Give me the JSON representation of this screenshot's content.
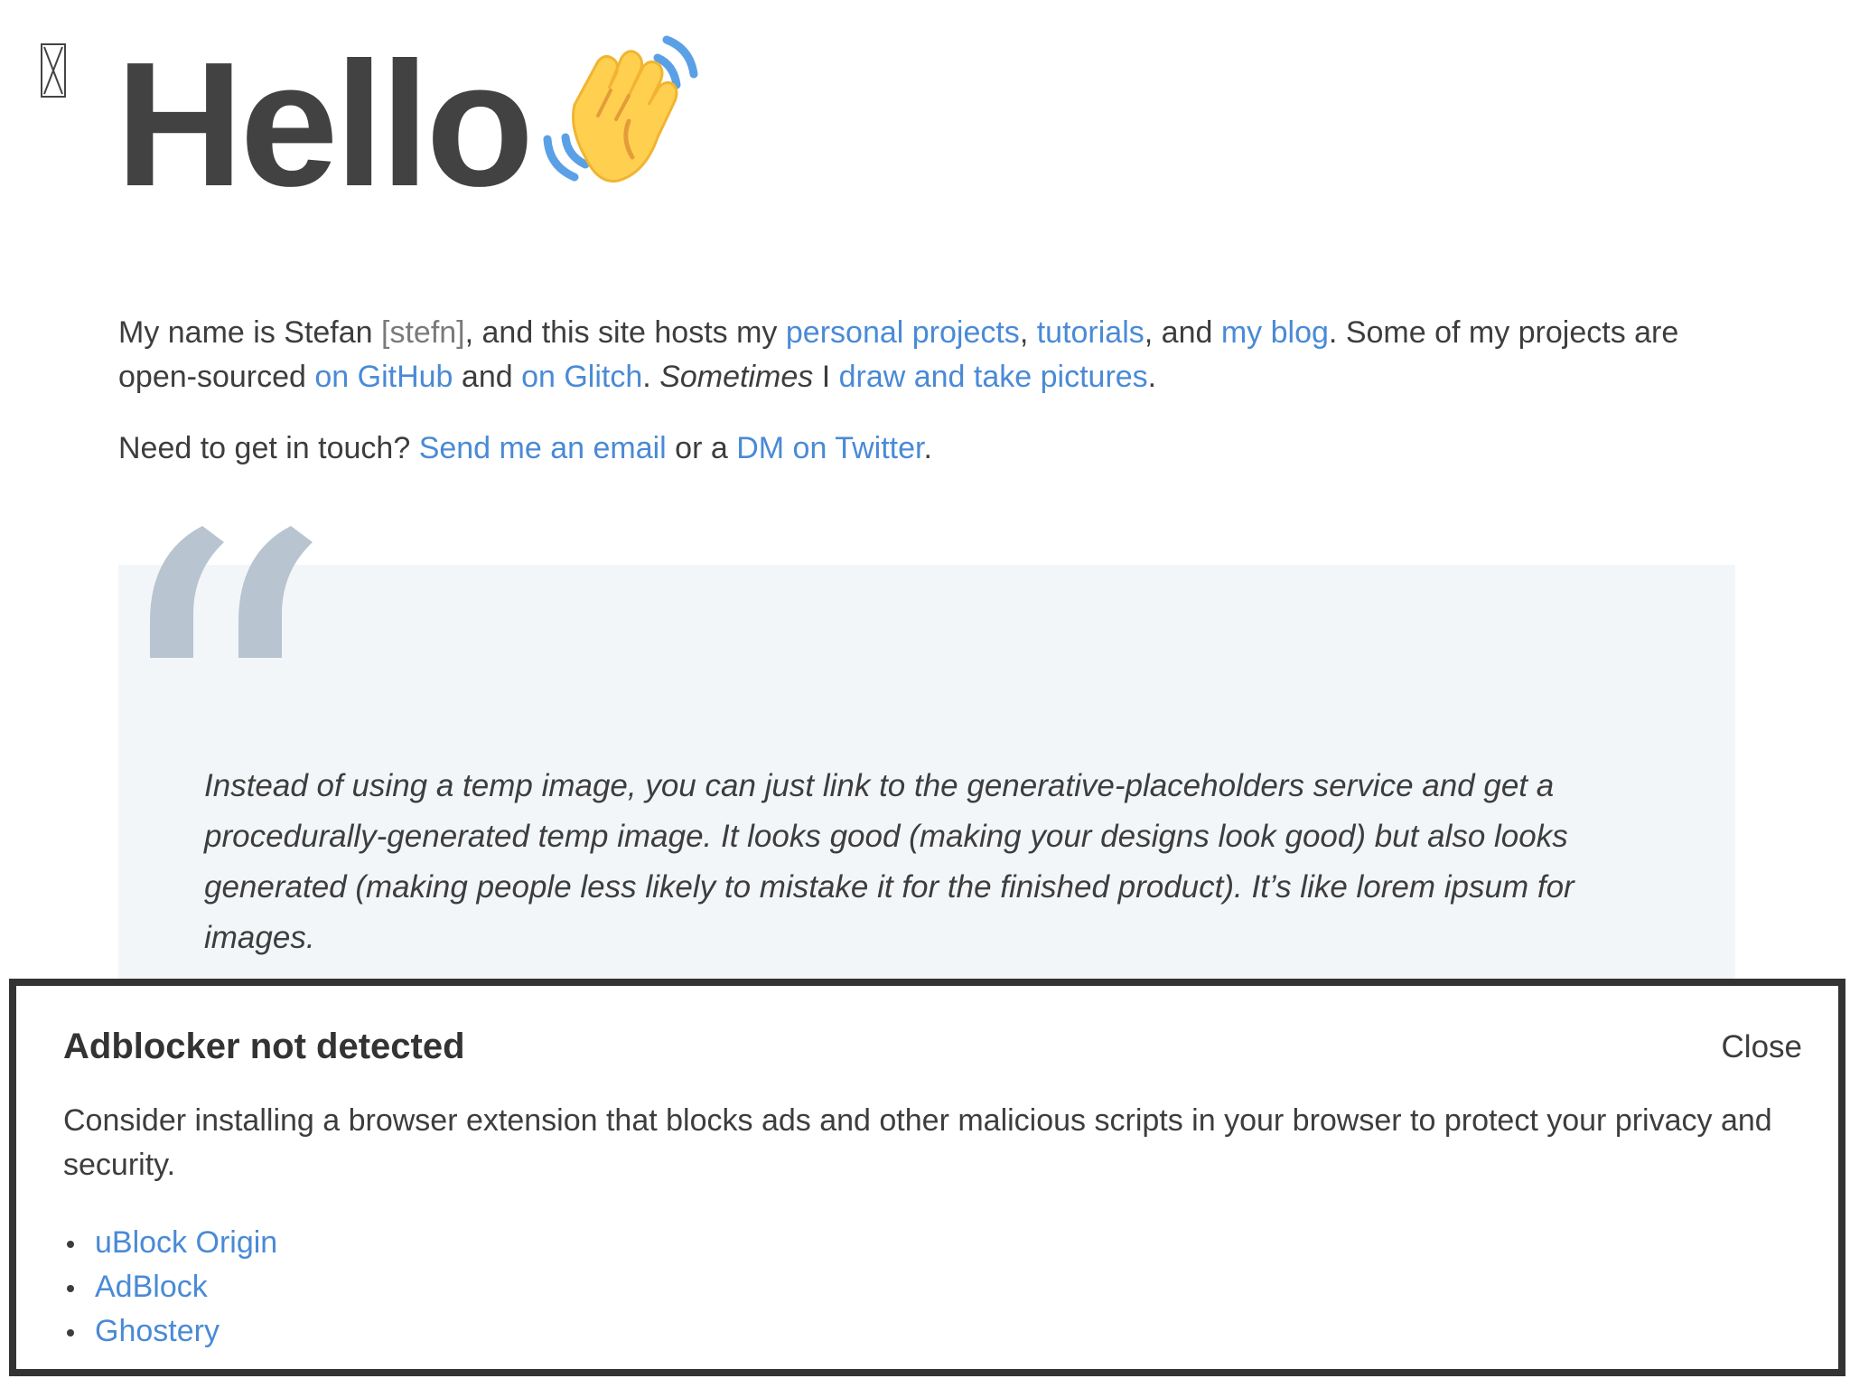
{
  "header": {
    "title": "Hello",
    "wave_icon": "waving-hand-emoji",
    "broken_image_icon": "broken-image-icon"
  },
  "intro": {
    "p1_before_pron": "My name is Stefan ",
    "pronunciation": "[stefn]",
    "p1_after_pron": ", and this site hosts my ",
    "link_projects": "personal projects",
    "comma1": ", ",
    "link_tutorials": "tutorials",
    "and1": ", and ",
    "link_blog": "my blog",
    "p1_mid": ". Some of my projects are open-sourced ",
    "link_github": "on GitHub",
    "and2": " and ",
    "link_glitch": "on Glitch",
    "period1": ". ",
    "sometimes": "Sometimes",
    "i_text": " I ",
    "link_draw": "draw and take pictures",
    "period2": ".",
    "p2_before": "Need to get in touch? ",
    "link_email": "Send me an email",
    "or_a": " or a ",
    "link_twitter": "DM on Twitter",
    "period3": "."
  },
  "quote": {
    "mark_icon": "quote-mark-icon",
    "text": "Instead of using a temp image, you can just link to the generative-placeholders service and get a procedurally-generated temp image. It looks good (making your designs look good) but also looks generated (making people less likely to mistake it for the finished product). It’s like lorem ipsum for images."
  },
  "banner": {
    "title": "Adblocker not detected",
    "close_label": "Close",
    "body": "Consider installing a browser extension that blocks ads and other malicious scripts in your browser to protect your privacy and security.",
    "links": [
      "uBlock Origin",
      "AdBlock",
      "Ghostery"
    ]
  },
  "colors": {
    "link": "#4a8ad6",
    "text": "#3d3d3d",
    "quote_bg": "#f3f6f9",
    "quote_mark": "#b9c4d1",
    "banner_border": "#333333"
  }
}
